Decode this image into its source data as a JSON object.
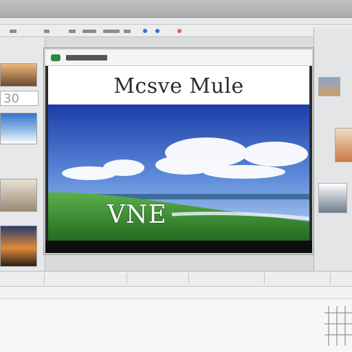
{
  "slide": {
    "title": "Mcsve Mule",
    "caption": "VNE"
  },
  "left_panel": {
    "label": "30"
  },
  "colors": {
    "sky_top": "#1c3da8",
    "sky_bottom": "#8fb4e6",
    "grass": "#2f8a2c",
    "record_button": "#2a8a3a",
    "accent_blue": "#2d6fd4",
    "accent_red": "#e05a5a"
  },
  "icons": [
    "record-icon",
    "minimize-icon",
    "maximize-icon",
    "close-icon",
    "play-icon",
    "settings-icon"
  ]
}
